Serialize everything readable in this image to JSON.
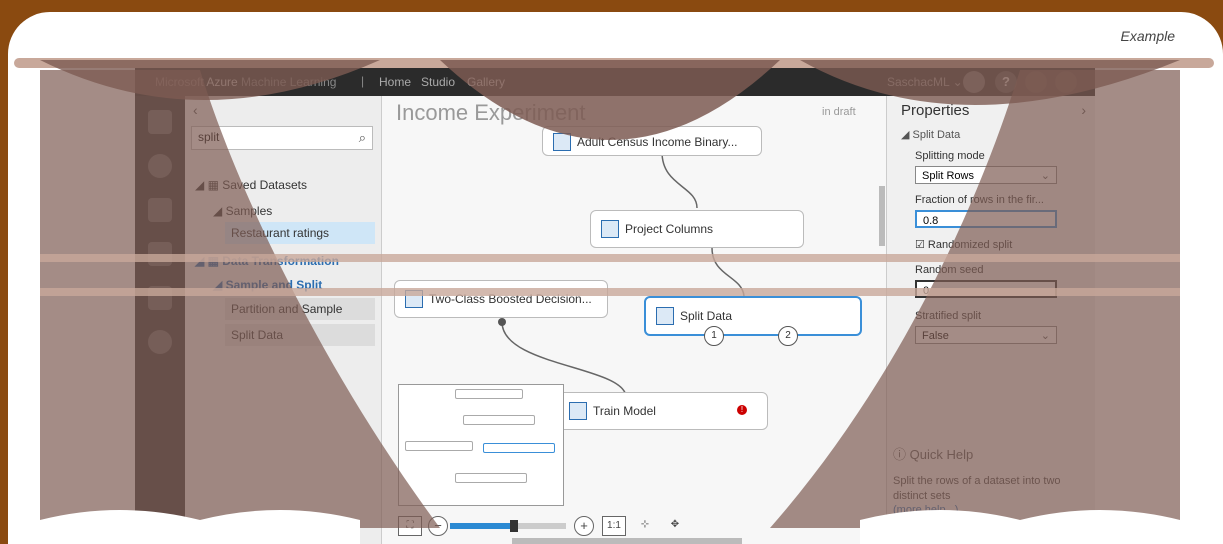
{
  "decoration": {
    "example_label": "Example"
  },
  "topbar": {
    "brand_main": "Microsoft Azure",
    "brand_light": "Machine Learning",
    "separator": "|",
    "nav": [
      "Home",
      "Studio",
      "Gallery"
    ],
    "user": "SaschacML ⌄",
    "help_icon_glyph": "?"
  },
  "palette": {
    "collapse_glyph": "‹",
    "search_value": "split",
    "tree": {
      "saved_datasets": "Saved Datasets",
      "samples": "Samples",
      "restaurant_ratings": "Restaurant ratings",
      "data_transformation": "Data Transformation",
      "sample_and_split": "Sample and Split",
      "partition_and_sample": "Partition and Sample",
      "split_data": "Split Data"
    }
  },
  "canvas": {
    "title": "Income Experiment",
    "draft": "in draft",
    "nodes": {
      "adult_census": "Adult Census Income Binary...",
      "project_columns": "Project Columns",
      "two_class": "Two-Class Boosted Decision...",
      "split_data": "Split Data",
      "train_model": "Train Model"
    },
    "split_ports": [
      "1",
      "2"
    ],
    "error_glyph": "!",
    "minimap": {
      "adult_census": "Adult Census Income Binary...",
      "project_columns": "Project Columns",
      "two_class": "Two-Class Boosted Decision...",
      "split_data": "Split Data",
      "train_model": "Train Model"
    },
    "zoom": {
      "minus": "−",
      "plus": "+",
      "actual": "1:1",
      "level_fraction": 0.55
    }
  },
  "properties": {
    "title": "Properties",
    "expand_glyph": "›",
    "section": "Split Data",
    "splitting_mode_label": "Splitting mode",
    "splitting_mode_value": "Split Rows",
    "fraction_label": "Fraction of rows in the fir...",
    "fraction_value": "0.8",
    "randomized_label": "Randomized split",
    "randomized_checked": true,
    "seed_label": "Random seed",
    "seed_value": "0",
    "stratified_label": "Stratified split",
    "stratified_value": "False",
    "quick_help_title": "Quick Help",
    "quick_help_text": "Split the rows of a dataset into two distinct sets",
    "quick_help_link": "(more help...)"
  },
  "colors": {
    "accent": "#2b8ad3",
    "frame_brown": "#8a4a10",
    "curtain": "#7d5b52",
    "curtain_light": "#c8a89a"
  }
}
